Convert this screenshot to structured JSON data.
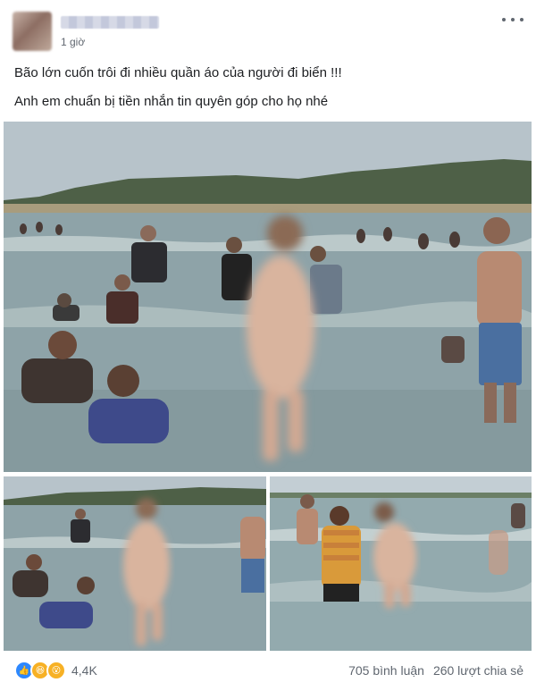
{
  "post": {
    "author_name": "",
    "timestamp": "1 giờ",
    "text_lines": [
      "Bão lớn cuốn trôi đi nhiều quần áo của người đi biển !!!",
      "Anh em chuẩn bị tiền nhắn tin quyên góp cho họ nhé"
    ]
  },
  "photos": [
    {
      "icon": "beach-photo",
      "scene": "main"
    },
    {
      "icon": "beach-photo",
      "scene": "left"
    },
    {
      "icon": "beach-photo",
      "scene": "right"
    }
  ],
  "reactions": {
    "icons": [
      "like-icon",
      "haha-icon",
      "wow-icon"
    ],
    "count": "4,4K"
  },
  "stats": {
    "comments": "705 bình luận",
    "shares": "260 lượt chia sẻ"
  },
  "colors": {
    "sky": "#b7c3ca",
    "sea": "#8ea3a8",
    "text_secondary": "#606770",
    "like_blue": "#2d88ff"
  }
}
